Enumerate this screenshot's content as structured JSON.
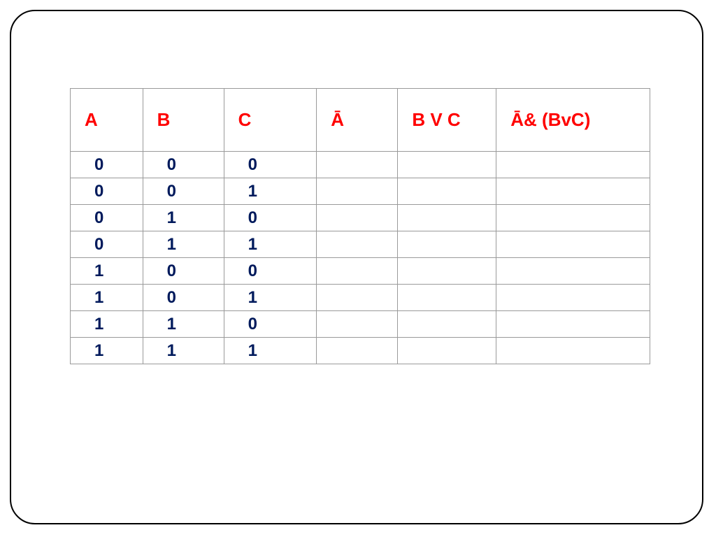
{
  "table": {
    "headers": [
      "A",
      "B",
      "C",
      "Ā",
      "B V C",
      "Ā& (BvC)"
    ],
    "rows": [
      [
        "0",
        "0",
        "0",
        "",
        "",
        ""
      ],
      [
        "0",
        "0",
        "1",
        "",
        "",
        ""
      ],
      [
        "0",
        "1",
        "0",
        "",
        "",
        ""
      ],
      [
        "0",
        "1",
        "1",
        "",
        "",
        ""
      ],
      [
        "1",
        "0",
        "0",
        "",
        "",
        ""
      ],
      [
        "1",
        "0",
        "1",
        "",
        "",
        ""
      ],
      [
        "1",
        "1",
        "0",
        "",
        "",
        ""
      ],
      [
        "1",
        "1",
        "1",
        "",
        "",
        ""
      ]
    ]
  }
}
